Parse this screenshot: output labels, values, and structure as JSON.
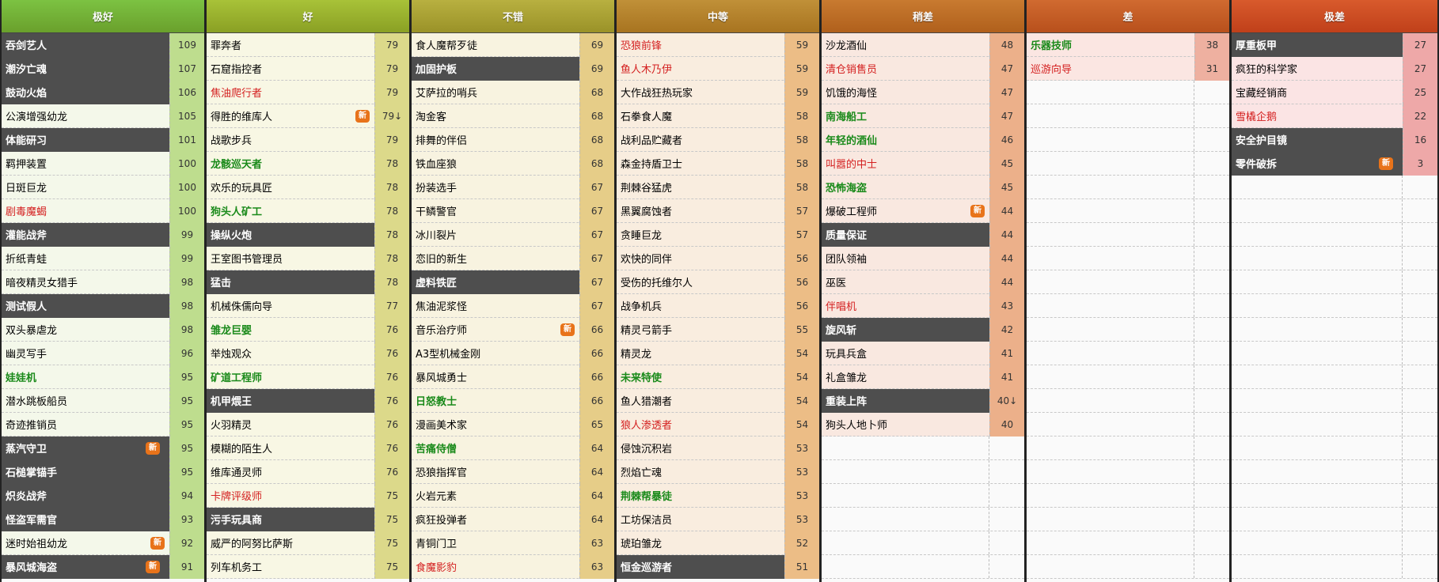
{
  "tiers": [
    {
      "label": "极好",
      "colors": {
        "header_from": "#7cc242",
        "header_to": "#6aa02c",
        "row_bg": "#f4f8ea",
        "score_bg": "#bedd8e"
      },
      "rows": [
        {
          "name": "吞剑艺人",
          "score": "109",
          "style": "dark"
        },
        {
          "name": "潮汐亡魂",
          "score": "107",
          "style": "dark"
        },
        {
          "name": "鼓动火焰",
          "score": "106",
          "style": "dark"
        },
        {
          "name": "公演增强幼龙",
          "score": "105",
          "style": "normal"
        },
        {
          "name": "体能研习",
          "score": "101",
          "style": "dark"
        },
        {
          "name": "羁押装置",
          "score": "100",
          "style": "normal"
        },
        {
          "name": "日斑巨龙",
          "score": "100",
          "style": "normal"
        },
        {
          "name": "剧毒魔蝎",
          "score": "100",
          "style": "red"
        },
        {
          "name": "灌能战斧",
          "score": "99",
          "style": "dark"
        },
        {
          "name": "折纸青蛙",
          "score": "99",
          "style": "normal"
        },
        {
          "name": "暗夜精灵女猎手",
          "score": "98",
          "style": "normal"
        },
        {
          "name": "测试假人",
          "score": "98",
          "style": "dark"
        },
        {
          "name": "双头暴虐龙",
          "score": "98",
          "style": "normal"
        },
        {
          "name": "幽灵写手",
          "score": "96",
          "style": "normal"
        },
        {
          "name": "娃娃机",
          "score": "95",
          "style": "green"
        },
        {
          "name": "潜水跳板船员",
          "score": "95",
          "style": "normal"
        },
        {
          "name": "奇迹推销员",
          "score": "95",
          "style": "normal"
        },
        {
          "name": "蒸汽守卫",
          "score": "95",
          "style": "dark",
          "badge": "新"
        },
        {
          "name": "石槌掌锚手",
          "score": "95",
          "style": "dark"
        },
        {
          "name": "炽炎战斧",
          "score": "94",
          "style": "dark"
        },
        {
          "name": "怪盗军需官",
          "score": "93",
          "style": "dark"
        },
        {
          "name": "迷时始祖幼龙",
          "score": "92",
          "style": "normal",
          "badge": "新"
        },
        {
          "name": "暴风城海盗",
          "score": "91",
          "style": "dark",
          "badge": "新"
        }
      ]
    },
    {
      "label": "好",
      "colors": {
        "header_from": "#a8c238",
        "header_to": "#8aa024",
        "row_bg": "#f8f7e4",
        "score_bg": "#dcd98a"
      },
      "rows": [
        {
          "name": "罪奔者",
          "score": "79",
          "style": "normal"
        },
        {
          "name": "石窟指控者",
          "score": "79",
          "style": "normal"
        },
        {
          "name": "焦油爬行者",
          "score": "79",
          "style": "red"
        },
        {
          "name": "得胜的维库人",
          "score": "79↓",
          "style": "normal",
          "badge": "新"
        },
        {
          "name": "战歌步兵",
          "score": "79",
          "style": "normal"
        },
        {
          "name": "龙骸巡天者",
          "score": "78",
          "style": "green"
        },
        {
          "name": "欢乐的玩具匠",
          "score": "78",
          "style": "normal"
        },
        {
          "name": "狗头人矿工",
          "score": "78",
          "style": "green"
        },
        {
          "name": "操纵火炮",
          "score": "78",
          "style": "dark"
        },
        {
          "name": "王室图书管理员",
          "score": "78",
          "style": "normal"
        },
        {
          "name": "猛击",
          "score": "78",
          "style": "dark"
        },
        {
          "name": "机械侏儒向导",
          "score": "77",
          "style": "normal"
        },
        {
          "name": "雏龙巨婴",
          "score": "76",
          "style": "green"
        },
        {
          "name": "举烛观众",
          "score": "76",
          "style": "normal"
        },
        {
          "name": "矿道工程师",
          "score": "76",
          "style": "green"
        },
        {
          "name": "机甲煨王",
          "score": "76",
          "style": "dark"
        },
        {
          "name": "火羽精灵",
          "score": "76",
          "style": "normal"
        },
        {
          "name": "模糊的陌生人",
          "score": "76",
          "style": "normal"
        },
        {
          "name": "维库通灵师",
          "score": "76",
          "style": "normal"
        },
        {
          "name": "卡牌评级师",
          "score": "75",
          "style": "red"
        },
        {
          "name": "污手玩具商",
          "score": "75",
          "style": "dark"
        },
        {
          "name": "威严的阿努比萨斯",
          "score": "75",
          "style": "normal"
        },
        {
          "name": "列车机务工",
          "score": "75",
          "style": "normal"
        }
      ]
    },
    {
      "label": "不错",
      "colors": {
        "header_from": "#b8b040",
        "header_to": "#9a9228",
        "row_bg": "#f8f3e0",
        "score_bg": "#e6cd88"
      },
      "rows": [
        {
          "name": "食人魔帮歹徒",
          "score": "69",
          "style": "normal"
        },
        {
          "name": "加固护板",
          "score": "69",
          "style": "dark"
        },
        {
          "name": "艾萨拉的哨兵",
          "score": "68",
          "style": "normal"
        },
        {
          "name": "淘金客",
          "score": "68",
          "style": "normal"
        },
        {
          "name": "排舞的伴侣",
          "score": "68",
          "style": "normal"
        },
        {
          "name": "铁血座狼",
          "score": "68",
          "style": "normal"
        },
        {
          "name": "扮装选手",
          "score": "67",
          "style": "normal"
        },
        {
          "name": "干鳞警官",
          "score": "67",
          "style": "normal"
        },
        {
          "name": "冰川裂片",
          "score": "67",
          "style": "normal"
        },
        {
          "name": "恋旧的新生",
          "score": "67",
          "style": "normal"
        },
        {
          "name": "虚料铁匠",
          "score": "67",
          "style": "dark"
        },
        {
          "name": "焦油泥浆怪",
          "score": "67",
          "style": "normal"
        },
        {
          "name": "音乐治疗师",
          "score": "66",
          "style": "normal",
          "badge": "新"
        },
        {
          "name": "A3型机械金刚",
          "score": "66",
          "style": "normal"
        },
        {
          "name": "暴风城勇士",
          "score": "66",
          "style": "normal"
        },
        {
          "name": "日怒教士",
          "score": "66",
          "style": "green"
        },
        {
          "name": "漫画美术家",
          "score": "65",
          "style": "normal"
        },
        {
          "name": "苦痛侍僧",
          "score": "64",
          "style": "green"
        },
        {
          "name": "恐狼指挥官",
          "score": "64",
          "style": "normal"
        },
        {
          "name": "火岩元素",
          "score": "64",
          "style": "normal"
        },
        {
          "name": "疯狂投弹者",
          "score": "64",
          "style": "normal"
        },
        {
          "name": "青铜门卫",
          "score": "63",
          "style": "normal"
        },
        {
          "name": "食魔影豹",
          "score": "63",
          "style": "red"
        }
      ]
    },
    {
      "label": "中等",
      "colors": {
        "header_from": "#c09038",
        "header_to": "#a87420",
        "row_bg": "#f9eddf",
        "score_bg": "#ecbd86"
      },
      "rows": [
        {
          "name": "恐狼前锋",
          "score": "59",
          "style": "red"
        },
        {
          "name": "鱼人木乃伊",
          "score": "59",
          "style": "red"
        },
        {
          "name": "大作战狂热玩家",
          "score": "59",
          "style": "normal"
        },
        {
          "name": "石拳食人魔",
          "score": "58",
          "style": "normal"
        },
        {
          "name": "战利品贮藏者",
          "score": "58",
          "style": "normal"
        },
        {
          "name": "森金持盾卫士",
          "score": "58",
          "style": "normal"
        },
        {
          "name": "荆棘谷猛虎",
          "score": "58",
          "style": "normal"
        },
        {
          "name": "黑翼腐蚀者",
          "score": "57",
          "style": "normal"
        },
        {
          "name": "贪睡巨龙",
          "score": "57",
          "style": "normal"
        },
        {
          "name": "欢快的同伴",
          "score": "56",
          "style": "normal"
        },
        {
          "name": "受伤的托维尔人",
          "score": "56",
          "style": "normal"
        },
        {
          "name": "战争机兵",
          "score": "56",
          "style": "normal"
        },
        {
          "name": "精灵弓箭手",
          "score": "55",
          "style": "normal"
        },
        {
          "name": "精灵龙",
          "score": "54",
          "style": "normal"
        },
        {
          "name": "未来特使",
          "score": "54",
          "style": "green"
        },
        {
          "name": "鱼人猎潮者",
          "score": "54",
          "style": "normal"
        },
        {
          "name": "狼人渗透者",
          "score": "54",
          "style": "red"
        },
        {
          "name": "侵蚀沉积岩",
          "score": "53",
          "style": "normal"
        },
        {
          "name": "烈焰亡魂",
          "score": "53",
          "style": "normal"
        },
        {
          "name": "荆棘帮暴徒",
          "score": "53",
          "style": "green"
        },
        {
          "name": "工坊保洁员",
          "score": "53",
          "style": "normal"
        },
        {
          "name": "琥珀雏龙",
          "score": "52",
          "style": "normal"
        },
        {
          "name": "恒金巡游者",
          "score": "51",
          "style": "dark"
        }
      ]
    },
    {
      "label": "稍差",
      "colors": {
        "header_from": "#c87a30",
        "header_to": "#b0601c",
        "row_bg": "#f9e8e0",
        "score_bg": "#ecb08a"
      },
      "rows": [
        {
          "name": "沙龙酒仙",
          "score": "48",
          "style": "normal"
        },
        {
          "name": "清仓销售员",
          "score": "47",
          "style": "red"
        },
        {
          "name": "饥饿的海怪",
          "score": "47",
          "style": "normal"
        },
        {
          "name": "南海船工",
          "score": "47",
          "style": "green"
        },
        {
          "name": "年轻的酒仙",
          "score": "46",
          "style": "green"
        },
        {
          "name": "叫嚣的中士",
          "score": "45",
          "style": "red"
        },
        {
          "name": "恐怖海盗",
          "score": "45",
          "style": "green"
        },
        {
          "name": "爆破工程师",
          "score": "44",
          "style": "normal",
          "badge": "新"
        },
        {
          "name": "质量保证",
          "score": "44",
          "style": "dark"
        },
        {
          "name": "团队领袖",
          "score": "44",
          "style": "normal"
        },
        {
          "name": "巫医",
          "score": "44",
          "style": "normal"
        },
        {
          "name": "伴唱机",
          "score": "43",
          "style": "red"
        },
        {
          "name": "旋风斩",
          "score": "42",
          "style": "dark"
        },
        {
          "name": "玩具兵盒",
          "score": "41",
          "style": "normal"
        },
        {
          "name": "礼盒雏龙",
          "score": "41",
          "style": "normal"
        },
        {
          "name": "重装上阵",
          "score": "40↓",
          "style": "dark"
        },
        {
          "name": "狗头人地卜师",
          "score": "40",
          "style": "normal"
        }
      ]
    },
    {
      "label": "差",
      "colors": {
        "header_from": "#d06a30",
        "header_to": "#b8501c",
        "row_bg": "#fbe6e2",
        "score_bg": "#eeb0a0"
      },
      "rows": [
        {
          "name": "乐器技师",
          "score": "38",
          "style": "green"
        },
        {
          "name": "巡游向导",
          "score": "31",
          "style": "red"
        }
      ]
    },
    {
      "label": "极差",
      "colors": {
        "header_from": "#d85a2c",
        "header_to": "#c0401a",
        "row_bg": "#fbe4e4",
        "score_bg": "#eea8a8"
      },
      "rows": [
        {
          "name": "厚重板甲",
          "score": "27",
          "style": "dark"
        },
        {
          "name": "疯狂的科学家",
          "score": "27",
          "style": "normal"
        },
        {
          "name": "宝藏经销商",
          "score": "25",
          "style": "normal"
        },
        {
          "name": "雪橇企鹅",
          "score": "22",
          "style": "red"
        },
        {
          "name": "安全护目镜",
          "score": "16",
          "style": "dark"
        },
        {
          "name": "零件破拆",
          "score": "3",
          "style": "dark",
          "badge": "新"
        }
      ]
    }
  ]
}
